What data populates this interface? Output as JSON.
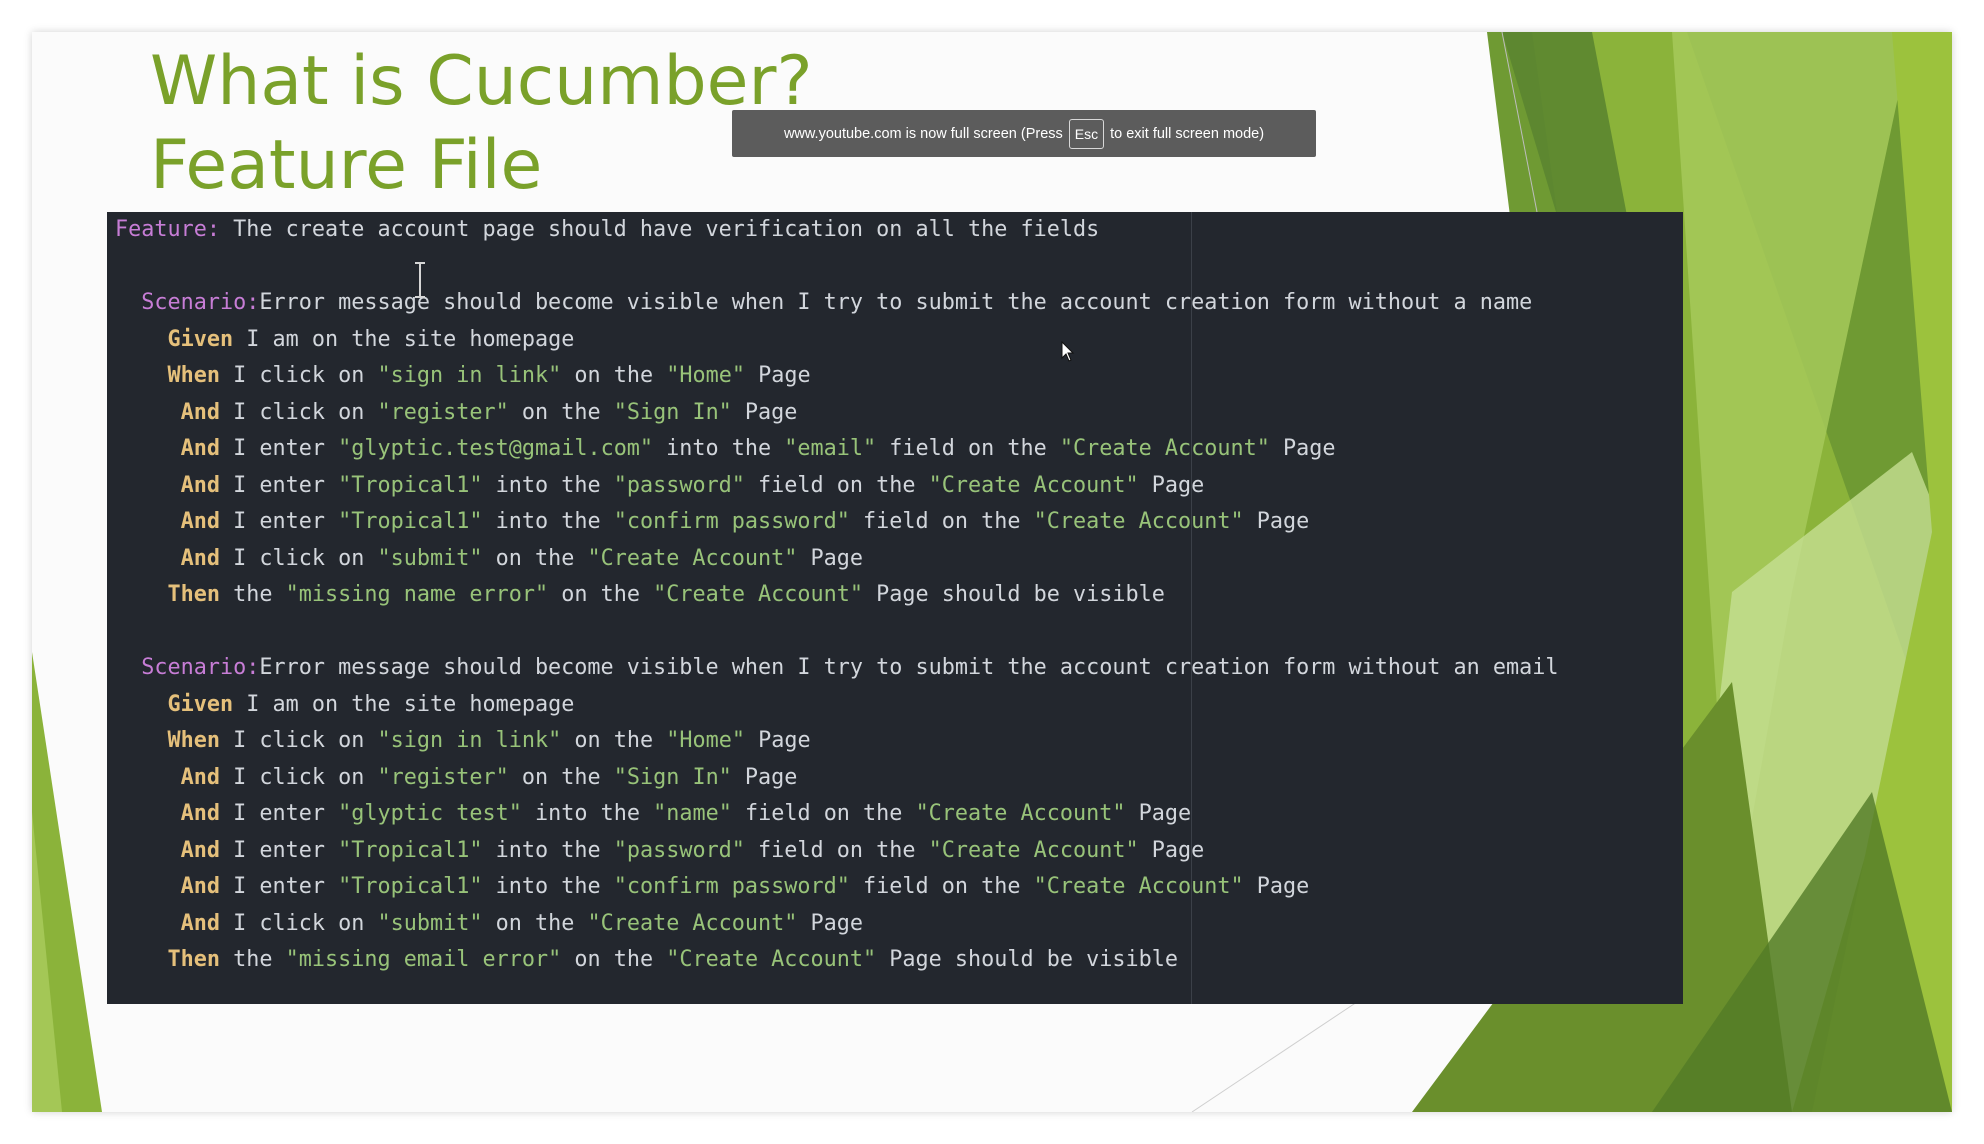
{
  "slide": {
    "title_line1": "What is Cucumber?",
    "title_line2": "Feature File",
    "accent_color": "#7aa12a",
    "decoration_colors": [
      "#8bb33a",
      "#a6c95a",
      "#6a8f2c",
      "#c5de92",
      "#527b27"
    ]
  },
  "fullscreen_toast": {
    "text_before": "www.youtube.com is now full screen (Press",
    "key": "Esc",
    "text_after": "to exit full screen mode)"
  },
  "code": {
    "lines": [
      [
        {
          "t": "feature",
          "v": "Feature:"
        },
        {
          "t": "text",
          "v": " The create account page should have verification on all the fields"
        }
      ],
      [],
      [
        {
          "t": "text",
          "v": "  "
        },
        {
          "t": "scenario",
          "v": "Scenario:"
        },
        {
          "t": "text",
          "v": "Error message should become visible when I try to submit the account creation form without a name"
        }
      ],
      [
        {
          "t": "text",
          "v": "    "
        },
        {
          "t": "keyword",
          "v": "Given"
        },
        {
          "t": "text",
          "v": " I am on the site homepage"
        }
      ],
      [
        {
          "t": "text",
          "v": "    "
        },
        {
          "t": "keyword",
          "v": "When"
        },
        {
          "t": "text",
          "v": " I click on "
        },
        {
          "t": "string",
          "v": "\"sign in link\""
        },
        {
          "t": "text",
          "v": " on the "
        },
        {
          "t": "string",
          "v": "\"Home\""
        },
        {
          "t": "text",
          "v": " Page"
        }
      ],
      [
        {
          "t": "text",
          "v": "     "
        },
        {
          "t": "keyword",
          "v": "And"
        },
        {
          "t": "text",
          "v": " I click on "
        },
        {
          "t": "string",
          "v": "\"register\""
        },
        {
          "t": "text",
          "v": " on the "
        },
        {
          "t": "string",
          "v": "\"Sign In\""
        },
        {
          "t": "text",
          "v": " Page"
        }
      ],
      [
        {
          "t": "text",
          "v": "     "
        },
        {
          "t": "keyword",
          "v": "And"
        },
        {
          "t": "text",
          "v": " I enter "
        },
        {
          "t": "string",
          "v": "\"glyptic.test@gmail.com\""
        },
        {
          "t": "text",
          "v": " into the "
        },
        {
          "t": "string",
          "v": "\"email\""
        },
        {
          "t": "text",
          "v": " field on the "
        },
        {
          "t": "string",
          "v": "\"Create Account\""
        },
        {
          "t": "text",
          "v": " Page"
        }
      ],
      [
        {
          "t": "text",
          "v": "     "
        },
        {
          "t": "keyword",
          "v": "And"
        },
        {
          "t": "text",
          "v": " I enter "
        },
        {
          "t": "string",
          "v": "\"Tropical1\""
        },
        {
          "t": "text",
          "v": " into the "
        },
        {
          "t": "string",
          "v": "\"password\""
        },
        {
          "t": "text",
          "v": " field on the "
        },
        {
          "t": "string",
          "v": "\"Create Account\""
        },
        {
          "t": "text",
          "v": " Page"
        }
      ],
      [
        {
          "t": "text",
          "v": "     "
        },
        {
          "t": "keyword",
          "v": "And"
        },
        {
          "t": "text",
          "v": " I enter "
        },
        {
          "t": "string",
          "v": "\"Tropical1\""
        },
        {
          "t": "text",
          "v": " into the "
        },
        {
          "t": "string",
          "v": "\"confirm password\""
        },
        {
          "t": "text",
          "v": " field on the "
        },
        {
          "t": "string",
          "v": "\"Create Account\""
        },
        {
          "t": "text",
          "v": " Page"
        }
      ],
      [
        {
          "t": "text",
          "v": "     "
        },
        {
          "t": "keyword",
          "v": "And"
        },
        {
          "t": "text",
          "v": " I click on "
        },
        {
          "t": "string",
          "v": "\"submit\""
        },
        {
          "t": "text",
          "v": " on the "
        },
        {
          "t": "string",
          "v": "\"Create Account\""
        },
        {
          "t": "text",
          "v": " Page"
        }
      ],
      [
        {
          "t": "text",
          "v": "    "
        },
        {
          "t": "keyword",
          "v": "Then"
        },
        {
          "t": "text",
          "v": " the "
        },
        {
          "t": "string",
          "v": "\"missing name error\""
        },
        {
          "t": "text",
          "v": " on the "
        },
        {
          "t": "string",
          "v": "\"Create Account\""
        },
        {
          "t": "text",
          "v": " Page should be visible"
        }
      ],
      [],
      [
        {
          "t": "text",
          "v": "  "
        },
        {
          "t": "scenario",
          "v": "Scenario:"
        },
        {
          "t": "text",
          "v": "Error message should become visible when I try to submit the account creation form without an email"
        }
      ],
      [
        {
          "t": "text",
          "v": "    "
        },
        {
          "t": "keyword",
          "v": "Given"
        },
        {
          "t": "text",
          "v": " I am on the site homepage"
        }
      ],
      [
        {
          "t": "text",
          "v": "    "
        },
        {
          "t": "keyword",
          "v": "When"
        },
        {
          "t": "text",
          "v": " I click on "
        },
        {
          "t": "string",
          "v": "\"sign in link\""
        },
        {
          "t": "text",
          "v": " on the "
        },
        {
          "t": "string",
          "v": "\"Home\""
        },
        {
          "t": "text",
          "v": " Page"
        }
      ],
      [
        {
          "t": "text",
          "v": "     "
        },
        {
          "t": "keyword",
          "v": "And"
        },
        {
          "t": "text",
          "v": " I click on "
        },
        {
          "t": "string",
          "v": "\"register\""
        },
        {
          "t": "text",
          "v": " on the "
        },
        {
          "t": "string",
          "v": "\"Sign In\""
        },
        {
          "t": "text",
          "v": " Page"
        }
      ],
      [
        {
          "t": "text",
          "v": "     "
        },
        {
          "t": "keyword",
          "v": "And"
        },
        {
          "t": "text",
          "v": " I enter "
        },
        {
          "t": "string",
          "v": "\"glyptic test\""
        },
        {
          "t": "text",
          "v": " into the "
        },
        {
          "t": "string",
          "v": "\"name\""
        },
        {
          "t": "text",
          "v": " field on the "
        },
        {
          "t": "string",
          "v": "\"Create Account\""
        },
        {
          "t": "text",
          "v": " Page"
        }
      ],
      [
        {
          "t": "text",
          "v": "     "
        },
        {
          "t": "keyword",
          "v": "And"
        },
        {
          "t": "text",
          "v": " I enter "
        },
        {
          "t": "string",
          "v": "\"Tropical1\""
        },
        {
          "t": "text",
          "v": " into the "
        },
        {
          "t": "string",
          "v": "\"password\""
        },
        {
          "t": "text",
          "v": " field on the "
        },
        {
          "t": "string",
          "v": "\"Create Account\""
        },
        {
          "t": "text",
          "v": " Page"
        }
      ],
      [
        {
          "t": "text",
          "v": "     "
        },
        {
          "t": "keyword",
          "v": "And"
        },
        {
          "t": "text",
          "v": " I enter "
        },
        {
          "t": "string",
          "v": "\"Tropical1\""
        },
        {
          "t": "text",
          "v": " into the "
        },
        {
          "t": "string",
          "v": "\"confirm password\""
        },
        {
          "t": "text",
          "v": " field on the "
        },
        {
          "t": "string",
          "v": "\"Create Account\""
        },
        {
          "t": "text",
          "v": " Page"
        }
      ],
      [
        {
          "t": "text",
          "v": "     "
        },
        {
          "t": "keyword",
          "v": "And"
        },
        {
          "t": "text",
          "v": " I click on "
        },
        {
          "t": "string",
          "v": "\"submit\""
        },
        {
          "t": "text",
          "v": " on the "
        },
        {
          "t": "string",
          "v": "\"Create Account\""
        },
        {
          "t": "text",
          "v": " Page"
        }
      ],
      [
        {
          "t": "text",
          "v": "    "
        },
        {
          "t": "keyword",
          "v": "Then"
        },
        {
          "t": "text",
          "v": " the "
        },
        {
          "t": "string",
          "v": "\"missing email error\""
        },
        {
          "t": "text",
          "v": " on the "
        },
        {
          "t": "string",
          "v": "\"Create Account\""
        },
        {
          "t": "text",
          "v": " Page should be visible"
        }
      ]
    ],
    "current_line": 21,
    "editor_background": "#23272e",
    "syntax_colors": {
      "feature": "#c77dd6",
      "keyword": "#e5c07b",
      "text": "#d2d6dc",
      "string": "#98c379"
    }
  },
  "icons": {
    "text_cursor": "i-beam-cursor-icon",
    "mouse_pointer": "mouse-pointer-icon"
  }
}
